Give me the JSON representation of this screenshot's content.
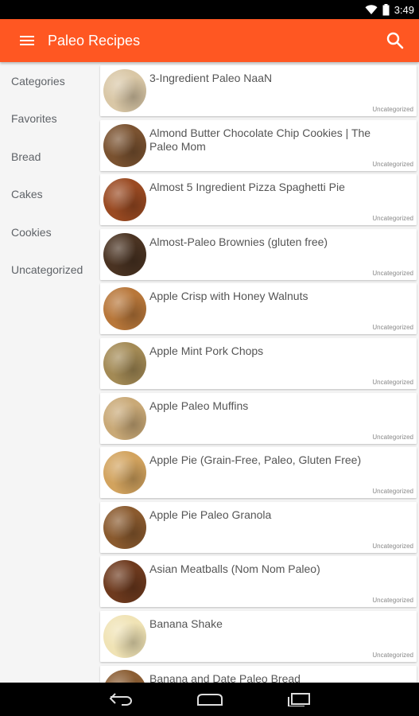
{
  "status_bar": {
    "time": "3:49",
    "icons": [
      "wifi-icon",
      "battery-icon"
    ]
  },
  "app_bar": {
    "title": "Paleo Recipes",
    "menu_icon": "hamburger-menu-icon",
    "search_icon": "search-icon",
    "color": "#ff5722"
  },
  "sidebar": {
    "items": [
      {
        "label": "Categories"
      },
      {
        "label": "Favorites"
      },
      {
        "label": "Bread"
      },
      {
        "label": "Cakes"
      },
      {
        "label": "Cookies"
      },
      {
        "label": "Uncategorized"
      }
    ]
  },
  "recipes": [
    {
      "title": "3-Ingredient Paleo NaaN",
      "category": "Uncategorized",
      "thumb_color": "#d9c7a6"
    },
    {
      "title": "Almond Butter Chocolate Chip Cookies | The Paleo Mom",
      "category": "Uncategorized",
      "thumb_color": "#7a5230"
    },
    {
      "title": "Almost 5 Ingredient Pizza Spaghetti Pie",
      "category": "Uncategorized",
      "thumb_color": "#9a4a22"
    },
    {
      "title": "Almost-Paleo Brownies (gluten free)",
      "category": "Uncategorized",
      "thumb_color": "#4a3322"
    },
    {
      "title": "Apple Crisp with Honey Walnuts",
      "category": "Uncategorized",
      "thumb_color": "#b8773a"
    },
    {
      "title": "Apple Mint Pork Chops",
      "category": "Uncategorized",
      "thumb_color": "#a38a55"
    },
    {
      "title": "Apple Paleo Muffins",
      "category": "Uncategorized",
      "thumb_color": "#c9a977"
    },
    {
      "title": "Apple Pie (Grain-Free, Paleo, Gluten Free)",
      "category": "Uncategorized",
      "thumb_color": "#d2a35e"
    },
    {
      "title": "Apple Pie Paleo Granola",
      "category": "Uncategorized",
      "thumb_color": "#8a5a2e"
    },
    {
      "title": "Asian Meatballs (Nom Nom Paleo)",
      "category": "Uncategorized",
      "thumb_color": "#6e3a1e"
    },
    {
      "title": "Banana Shake",
      "category": "Uncategorized",
      "thumb_color": "#f0e3b5"
    },
    {
      "title": "Banana and Date Paleo Bread",
      "category": "",
      "thumb_color": "#8b5e34"
    }
  ],
  "nav_bar": {
    "back_icon": "back-icon",
    "home_icon": "home-icon",
    "recents_icon": "recents-icon"
  }
}
